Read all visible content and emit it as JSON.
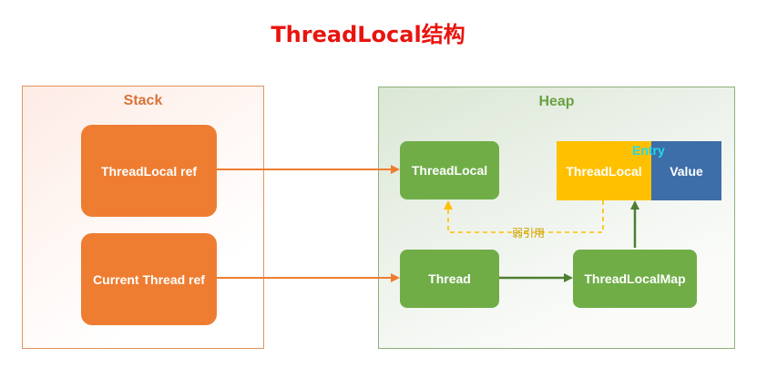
{
  "title": "ThreadLocal结构",
  "stack": {
    "label": "Stack",
    "threadlocal_ref": "ThreadLocal ref",
    "current_thread_ref": "Current Thread ref"
  },
  "heap": {
    "label": "Heap",
    "threadlocal": "ThreadLocal",
    "thread": "Thread",
    "threadlocalmap": "ThreadLocalMap",
    "entry": {
      "label": "Entry",
      "key": "ThreadLocal",
      "value": "Value"
    }
  },
  "weak_ref_label": "弱引用",
  "colors": {
    "title": "#e8140e",
    "stack_box": "#ee7d31",
    "heap_box": "#70ad47",
    "entry_key": "#ffc000",
    "entry_value": "#3e6ea8",
    "entry_label": "#21d9ea",
    "weak_ref": "#ffc000",
    "orange_arrow": "#ee7d31",
    "green_arrow": "#4d7f32"
  }
}
